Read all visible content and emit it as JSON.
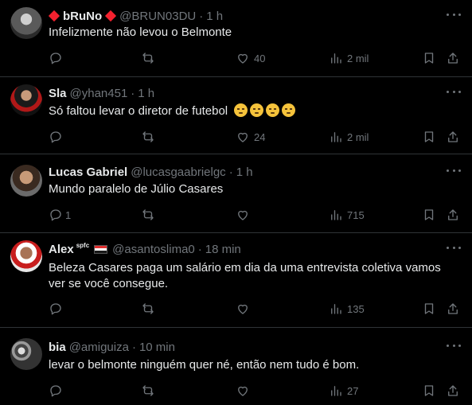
{
  "tweets": [
    {
      "name": "bRuNo",
      "handle": "@BRUN03DU",
      "time": "1 h",
      "text": "Infelizmente não levou o Belmonte",
      "replies": "",
      "retweets": "",
      "likes": "40",
      "views": "2 mil"
    },
    {
      "name": "Sla",
      "handle": "@yhan451",
      "time": "1 h",
      "text": "Só faltou levar o diretor de futebol",
      "replies": "",
      "retweets": "",
      "likes": "24",
      "views": "2 mil"
    },
    {
      "name": "Lucas Gabriel",
      "handle": "@lucasgaabrielgc",
      "time": "1 h",
      "text": "Mundo paralelo de Júlio Casares",
      "replies": "1",
      "retweets": "",
      "likes": "",
      "views": "715"
    },
    {
      "name": "Alex",
      "name_badge": "spfc",
      "handle": "@asantoslima0",
      "time": "18 min",
      "text": "Beleza Casares paga um salário em dia da uma entrevista coletiva vamos ver se você consegue.",
      "replies": "",
      "retweets": "",
      "likes": "",
      "views": "135"
    },
    {
      "name": "bia",
      "handle": "@amiguiza",
      "time": "10 min",
      "text": "levar o belmonte ninguém quer né, então nem tudo é bom.",
      "replies": "",
      "retweets": "",
      "likes": "",
      "views": "27"
    }
  ],
  "colors": {
    "background": "#000000",
    "text": "#e7e9ea",
    "muted": "#71767b",
    "divider": "#2f3336",
    "diamond": "#f4212e"
  },
  "icons": [
    "reply-icon",
    "retweet-icon",
    "like-icon",
    "views-icon",
    "bookmark-icon",
    "share-icon",
    "more-icon"
  ]
}
